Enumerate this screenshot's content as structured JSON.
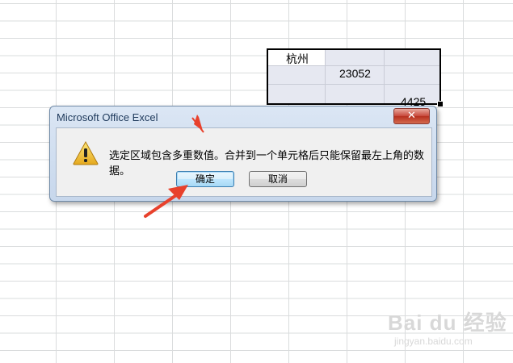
{
  "spreadsheet": {
    "cells": {
      "a1": "杭州",
      "b2": "23052",
      "c3": "4425"
    }
  },
  "dialog": {
    "title": "Microsoft Office Excel",
    "close_label": "✕",
    "message": "选定区域包含多重数值。合并到一个单元格后只能保留最左上角的数据。",
    "ok_label": "确定",
    "cancel_label": "取消",
    "icon": "warning-icon"
  },
  "watermark": {
    "logo": "Bai du 经验",
    "url": "jingyan.baidu.com"
  },
  "colors": {
    "annotation_arrow": "#e8412c",
    "selection_fill": "#e6e8f1",
    "dialog_frame": "#c7d7ec"
  }
}
